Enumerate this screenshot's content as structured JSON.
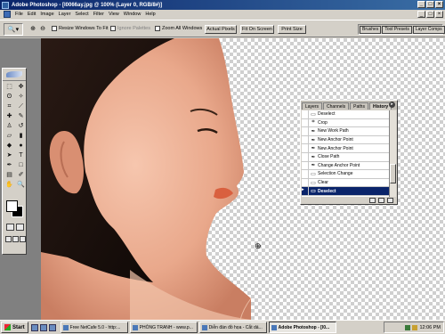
{
  "window": {
    "title": "Adobe Photoshop - [l0066ay.jpg @ 100% (Layer 0, RGB/8#)]",
    "controls": [
      "_",
      "□",
      "×"
    ]
  },
  "menubar": {
    "items": [
      "File",
      "Edit",
      "Image",
      "Layer",
      "Select",
      "Filter",
      "View",
      "Window",
      "Help"
    ]
  },
  "options": {
    "resize_windows": "Resize Windows To Fit",
    "ignore_palettes": "Ignore Palettes",
    "zoom_all": "Zoom All Windows",
    "actual_pixels": "Actual Pixels",
    "fit_on_screen": "Fit On Screen",
    "print_size": "Print Size",
    "palette_well_tabs": [
      "Brushes",
      "Tool Presets",
      "Layer Comps"
    ]
  },
  "history_panel": {
    "tabs": [
      "Layers",
      "Channels",
      "Paths",
      "History"
    ],
    "active_tab": "History",
    "items": [
      {
        "label": "Deselect",
        "icon": "▭"
      },
      {
        "label": "Crop",
        "icon": "⌗"
      },
      {
        "label": "New Work Path",
        "icon": "✒"
      },
      {
        "label": "New Anchor Point",
        "icon": "✒"
      },
      {
        "label": "New Anchor Point",
        "icon": "✒"
      },
      {
        "label": "Close Path",
        "icon": "✒"
      },
      {
        "label": "Change Anchor Point",
        "icon": "✒"
      },
      {
        "label": "Selection Change",
        "icon": "▭"
      },
      {
        "label": "Clear",
        "icon": "▭"
      },
      {
        "label": "Deselect",
        "icon": "▭"
      }
    ],
    "selected_index": 9
  },
  "taskbar": {
    "start": "Start",
    "buttons": [
      {
        "label": "Free NetCafe 5.0 - http:...",
        "active": false
      },
      {
        "label": "PHÒNG TRANH - www.p...",
        "active": false
      },
      {
        "label": "Diễn đàn đồ họa - Cắt dá...",
        "active": false
      },
      {
        "label": "Adobe Photoshop - [l0...",
        "active": true
      }
    ],
    "clock": "12:06 PM"
  },
  "colors": {
    "titlebar_start": "#0a246a",
    "titlebar_end": "#3a6ea5",
    "chrome": "#d4d0c8",
    "selection": "#0a246a",
    "skin": "#e8a98e"
  },
  "icons": {
    "toolbox": [
      "marquee-icon",
      "move-icon",
      "lasso-icon",
      "magic-wand-icon",
      "crop-icon",
      "slice-icon",
      "healing-brush-icon",
      "brush-icon",
      "clone-stamp-icon",
      "history-brush-icon",
      "eraser-icon",
      "gradient-icon",
      "blur-icon",
      "dodge-icon",
      "path-selection-icon",
      "type-icon",
      "pen-icon",
      "shape-icon",
      "notes-icon",
      "eyedropper-icon",
      "hand-icon",
      "zoom-icon"
    ]
  }
}
